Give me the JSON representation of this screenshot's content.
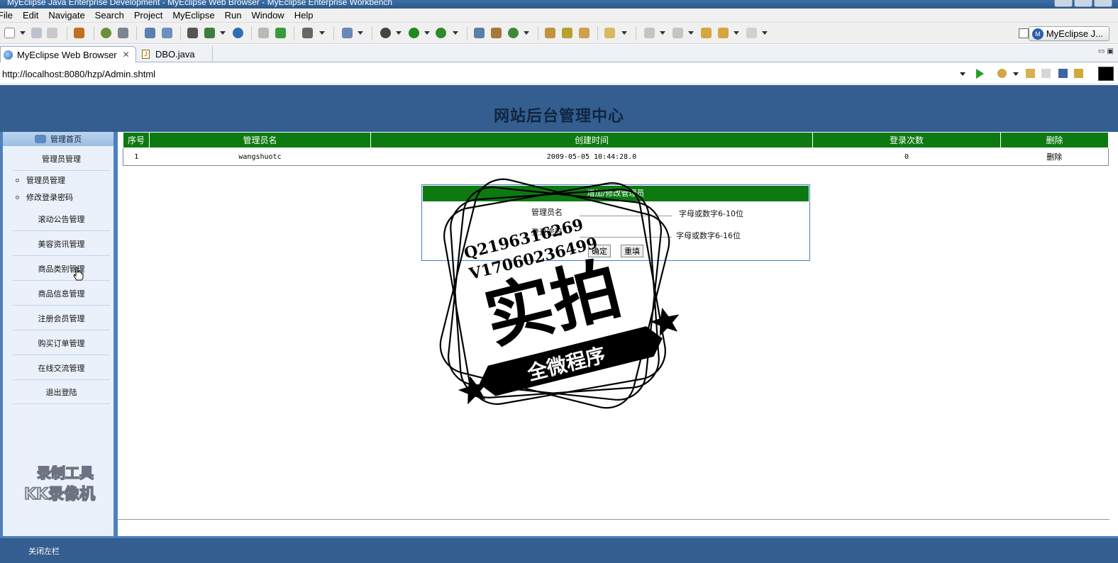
{
  "window": {
    "title": "MyEclipse Java Enterprise Development - MyEclipse Web Browser - MyEclipse Enterprise Workbench"
  },
  "menu": [
    "File",
    "Edit",
    "Navigate",
    "Search",
    "Project",
    "MyEclipse",
    "Run",
    "Window",
    "Help"
  ],
  "perspective": {
    "label": "MyEclipse J..."
  },
  "tabs": [
    {
      "label": "MyEclipse Web Browser",
      "close": "✕"
    },
    {
      "label": "DBO.java"
    }
  ],
  "address": {
    "url": "http://localhost:8080/hzp/Admin.shtml"
  },
  "site": {
    "title": "网站后台管理中心"
  },
  "sidebar": {
    "header": "管理首页",
    "section_admin": "管理员管理",
    "sub_items": [
      "管理员管理",
      "修改登录密码"
    ],
    "items": [
      "滚动公告管理",
      "美容资讯管理",
      "商品类别管理",
      "商品信息管理",
      "注册会员管理",
      "购买订单管理",
      "在线交流管理",
      "退出登陆"
    ]
  },
  "admin_table": {
    "columns": [
      "序号",
      "管理员名",
      "创建时间",
      "登录次数",
      "删除"
    ],
    "rows": [
      [
        "1",
        "wangshuotc",
        "2009-05-05 10:44:28.0",
        "0",
        "删除"
      ]
    ]
  },
  "form": {
    "title": "增加/修改管理员",
    "username_label": "管理员名",
    "username_hint": "字母或数字6-10位",
    "password_label": "登录密码",
    "password_hint": "字母或数字6-16位",
    "submit": "确定",
    "reset": "重填"
  },
  "footer": {
    "close_left": "关闭左栏"
  },
  "watermark": {
    "line1": "Q2196316269",
    "line2": "V17060236499",
    "big": "实拍",
    "banner": "全微程序"
  },
  "recorder": {
    "line1": "录制工具",
    "line2": "KK录像机"
  }
}
